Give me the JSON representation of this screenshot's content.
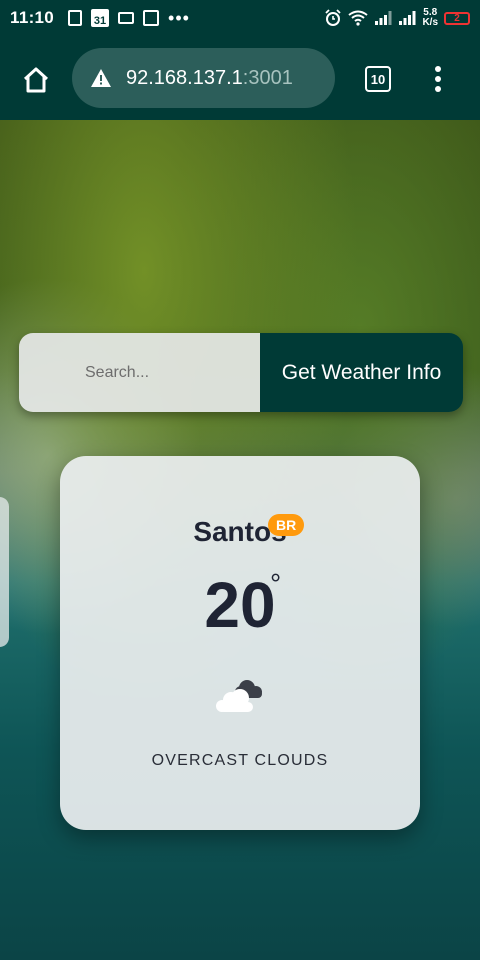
{
  "status_bar": {
    "time": "11:10",
    "calendar_day": "31",
    "net_speed_value": "5.8",
    "net_speed_unit": "K/s",
    "battery_level": "2"
  },
  "browser": {
    "url_host": "92.168.137.1",
    "url_port": ":3001",
    "tab_count": "10",
    "icons": [
      "home-icon",
      "warning-icon",
      "tabs-icon",
      "menu-icon"
    ]
  },
  "search": {
    "placeholder": "Search...",
    "button_label": "Get Weather Info"
  },
  "weather": {
    "city": "Santos",
    "country": "BR",
    "temperature": "20",
    "degree_symbol": "°",
    "icon": "overcast-clouds-icon",
    "description": "OVERCAST CLOUDS"
  },
  "colors": {
    "primary": "#003a36",
    "badge": "#ff9a0d",
    "card": "#ebeeef"
  }
}
